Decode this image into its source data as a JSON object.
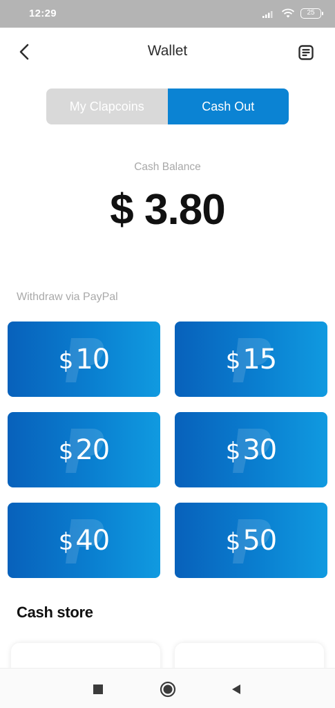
{
  "status_bar": {
    "time": "12:29",
    "battery": "25"
  },
  "header": {
    "title": "Wallet"
  },
  "tabs": [
    {
      "label": "My Clapcoins",
      "active": false
    },
    {
      "label": "Cash Out",
      "active": true
    }
  ],
  "balance": {
    "label": "Cash Balance",
    "value": "$ 3.80"
  },
  "withdraw": {
    "label": "Withdraw via PayPal",
    "options": [
      {
        "currency": "$",
        "amount": "10"
      },
      {
        "currency": "$",
        "amount": "15"
      },
      {
        "currency": "$",
        "amount": "20"
      },
      {
        "currency": "$",
        "amount": "30"
      },
      {
        "currency": "$",
        "amount": "40"
      },
      {
        "currency": "$",
        "amount": "50"
      }
    ]
  },
  "store": {
    "heading": "Cash store"
  },
  "colors": {
    "accent": "#0b83d3",
    "card_dark": "#0861bb",
    "card_light": "#109ae0"
  }
}
